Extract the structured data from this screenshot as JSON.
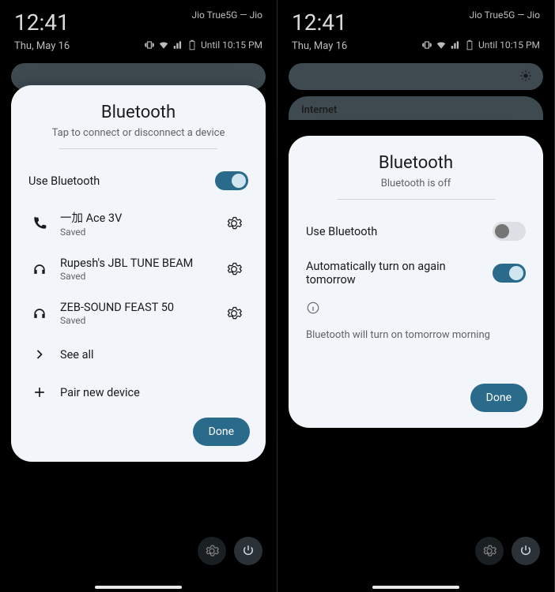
{
  "status": {
    "clock": "12:41",
    "date": "Thu, May 16",
    "carrier": "Jio True5G — Jio",
    "until": "Until 10:15 PM"
  },
  "card_on": {
    "title": "Bluetooth",
    "subtitle": "Tap to connect or disconnect a device",
    "use_bt": "Use Bluetooth",
    "devices": [
      {
        "name": "一加 Ace 3V",
        "status": "Saved",
        "icon": "phone"
      },
      {
        "name": "Rupesh's JBL TUNE BEAM",
        "status": "Saved",
        "icon": "headphones"
      },
      {
        "name": "ZEB-SOUND FEAST 50",
        "status": "Saved",
        "icon": "headphones"
      }
    ],
    "see_all": "See all",
    "pair_new": "Pair new device",
    "done": "Done"
  },
  "card_off": {
    "title": "Bluetooth",
    "subtitle": "Bluetooth is off",
    "use_bt": "Use Bluetooth",
    "auto_on": "Automatically turn on again tomorrow",
    "info": "Bluetooth will turn on tomorrow morning",
    "done": "Done"
  },
  "bg_panel_label": "Internet"
}
